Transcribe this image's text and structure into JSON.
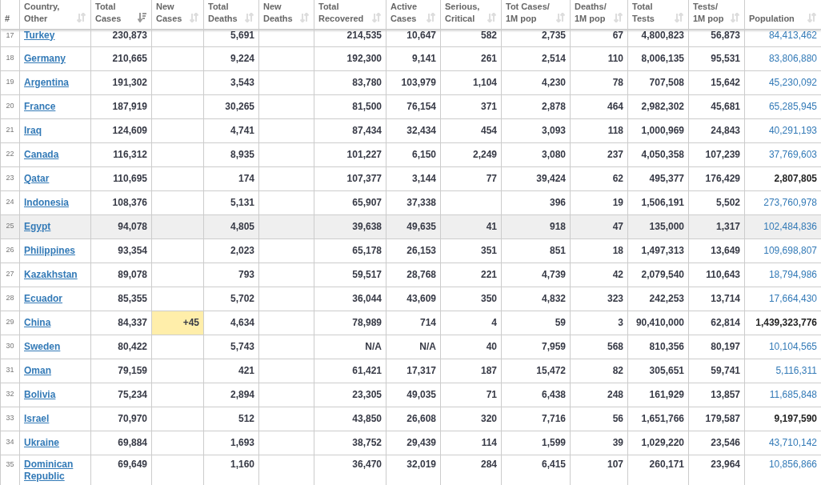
{
  "columns": [
    {
      "label": "#"
    },
    {
      "label": "Country,\nOther",
      "sorted": false
    },
    {
      "label": "Total\nCases",
      "sorted": true
    },
    {
      "label": "New\nCases",
      "sorted": false
    },
    {
      "label": "Total\nDeaths",
      "sorted": false
    },
    {
      "label": "New\nDeaths",
      "sorted": false
    },
    {
      "label": "Total\nRecovered",
      "sorted": false
    },
    {
      "label": "Active\nCases",
      "sorted": false
    },
    {
      "label": "Serious,\nCritical",
      "sorted": false
    },
    {
      "label": "Tot Cases/\n1M pop",
      "sorted": false
    },
    {
      "label": "Deaths/\n1M pop",
      "sorted": false
    },
    {
      "label": "Total\nTests",
      "sorted": false
    },
    {
      "label": "Tests/\n1M pop",
      "sorted": false
    },
    {
      "label": "Population",
      "sorted": false
    }
  ],
  "rows": [
    {
      "rank": "17",
      "country": "Turkey",
      "total_cases": "230,873",
      "total_deaths": "5,691",
      "total_recovered": "214,535",
      "active_cases": "10,647",
      "serious_critical": "582",
      "cases_per_1m": "2,735",
      "deaths_per_1m": "67",
      "total_tests": "4,800,823",
      "tests_per_1m": "56,873",
      "population": "84,413,462",
      "population_linked": true,
      "highlighted": false
    },
    {
      "rank": "18",
      "country": "Germany",
      "total_cases": "210,665",
      "total_deaths": "9,224",
      "total_recovered": "192,300",
      "active_cases": "9,141",
      "serious_critical": "261",
      "cases_per_1m": "2,514",
      "deaths_per_1m": "110",
      "total_tests": "8,006,135",
      "tests_per_1m": "95,531",
      "population": "83,806,880",
      "population_linked": true,
      "highlighted": false
    },
    {
      "rank": "19",
      "country": "Argentina",
      "total_cases": "191,302",
      "total_deaths": "3,543",
      "total_recovered": "83,780",
      "active_cases": "103,979",
      "serious_critical": "1,104",
      "cases_per_1m": "4,230",
      "deaths_per_1m": "78",
      "total_tests": "707,508",
      "tests_per_1m": "15,642",
      "population": "45,230,092",
      "population_linked": true,
      "highlighted": false
    },
    {
      "rank": "20",
      "country": "France",
      "total_cases": "187,919",
      "total_deaths": "30,265",
      "total_recovered": "81,500",
      "active_cases": "76,154",
      "serious_critical": "371",
      "cases_per_1m": "2,878",
      "deaths_per_1m": "464",
      "total_tests": "2,982,302",
      "tests_per_1m": "45,681",
      "population": "65,285,945",
      "population_linked": true,
      "highlighted": false
    },
    {
      "rank": "21",
      "country": "Iraq",
      "total_cases": "124,609",
      "total_deaths": "4,741",
      "total_recovered": "87,434",
      "active_cases": "32,434",
      "serious_critical": "454",
      "cases_per_1m": "3,093",
      "deaths_per_1m": "118",
      "total_tests": "1,000,969",
      "tests_per_1m": "24,843",
      "population": "40,291,193",
      "population_linked": true,
      "highlighted": false
    },
    {
      "rank": "22",
      "country": "Canada",
      "total_cases": "116,312",
      "total_deaths": "8,935",
      "total_recovered": "101,227",
      "active_cases": "6,150",
      "serious_critical": "2,249",
      "cases_per_1m": "3,080",
      "deaths_per_1m": "237",
      "total_tests": "4,050,358",
      "tests_per_1m": "107,239",
      "population": "37,769,603",
      "population_linked": true,
      "highlighted": false
    },
    {
      "rank": "23",
      "country": "Qatar",
      "total_cases": "110,695",
      "total_deaths": "174",
      "total_recovered": "107,377",
      "active_cases": "3,144",
      "serious_critical": "77",
      "cases_per_1m": "39,424",
      "deaths_per_1m": "62",
      "total_tests": "495,377",
      "tests_per_1m": "176,429",
      "population": "2,807,805",
      "population_linked": false,
      "highlighted": false
    },
    {
      "rank": "24",
      "country": "Indonesia",
      "total_cases": "108,376",
      "total_deaths": "5,131",
      "total_recovered": "65,907",
      "active_cases": "37,338",
      "cases_per_1m": "396",
      "deaths_per_1m": "19",
      "total_tests": "1,506,191",
      "tests_per_1m": "5,502",
      "population": "273,760,978",
      "population_linked": true,
      "highlighted": false
    },
    {
      "rank": "25",
      "country": "Egypt",
      "total_cases": "94,078",
      "total_deaths": "4,805",
      "total_recovered": "39,638",
      "active_cases": "49,635",
      "serious_critical": "41",
      "cases_per_1m": "918",
      "deaths_per_1m": "47",
      "total_tests": "135,000",
      "tests_per_1m": "1,317",
      "population": "102,484,836",
      "population_linked": true,
      "highlighted": true
    },
    {
      "rank": "26",
      "country": "Philippines",
      "total_cases": "93,354",
      "total_deaths": "2,023",
      "total_recovered": "65,178",
      "active_cases": "26,153",
      "serious_critical": "351",
      "cases_per_1m": "851",
      "deaths_per_1m": "18",
      "total_tests": "1,497,313",
      "tests_per_1m": "13,649",
      "population": "109,698,807",
      "population_linked": true,
      "highlighted": false
    },
    {
      "rank": "27",
      "country": "Kazakhstan",
      "total_cases": "89,078",
      "total_deaths": "793",
      "total_recovered": "59,517",
      "active_cases": "28,768",
      "serious_critical": "221",
      "cases_per_1m": "4,739",
      "deaths_per_1m": "42",
      "total_tests": "2,079,540",
      "tests_per_1m": "110,643",
      "population": "18,794,986",
      "population_linked": true,
      "highlighted": false
    },
    {
      "rank": "28",
      "country": "Ecuador",
      "total_cases": "85,355",
      "total_deaths": "5,702",
      "total_recovered": "36,044",
      "active_cases": "43,609",
      "serious_critical": "350",
      "cases_per_1m": "4,832",
      "deaths_per_1m": "323",
      "total_tests": "242,253",
      "tests_per_1m": "13,714",
      "population": "17,664,430",
      "population_linked": true,
      "highlighted": false
    },
    {
      "rank": "29",
      "country": "China",
      "total_cases": "84,337",
      "new_cases": "+45",
      "total_deaths": "4,634",
      "total_recovered": "78,989",
      "active_cases": "714",
      "serious_critical": "4",
      "cases_per_1m": "59",
      "deaths_per_1m": "3",
      "total_tests": "90,410,000",
      "tests_per_1m": "62,814",
      "population": "1,439,323,776",
      "population_linked": false,
      "highlighted": false
    },
    {
      "rank": "30",
      "country": "Sweden",
      "total_cases": "80,422",
      "total_deaths": "5,743",
      "total_recovered": "N/A",
      "active_cases": "N/A",
      "serious_critical": "40",
      "cases_per_1m": "7,959",
      "deaths_per_1m": "568",
      "total_tests": "810,356",
      "tests_per_1m": "80,197",
      "population": "10,104,565",
      "population_linked": true,
      "highlighted": false
    },
    {
      "rank": "31",
      "country": "Oman",
      "total_cases": "79,159",
      "total_deaths": "421",
      "total_recovered": "61,421",
      "active_cases": "17,317",
      "serious_critical": "187",
      "cases_per_1m": "15,472",
      "deaths_per_1m": "82",
      "total_tests": "305,651",
      "tests_per_1m": "59,741",
      "population": "5,116,311",
      "population_linked": true,
      "highlighted": false
    },
    {
      "rank": "32",
      "country": "Bolivia",
      "total_cases": "75,234",
      "total_deaths": "2,894",
      "total_recovered": "23,305",
      "active_cases": "49,035",
      "serious_critical": "71",
      "cases_per_1m": "6,438",
      "deaths_per_1m": "248",
      "total_tests": "161,929",
      "tests_per_1m": "13,857",
      "population": "11,685,848",
      "population_linked": true,
      "highlighted": false
    },
    {
      "rank": "33",
      "country": "Israel",
      "total_cases": "70,970",
      "total_deaths": "512",
      "total_recovered": "43,850",
      "active_cases": "26,608",
      "serious_critical": "320",
      "cases_per_1m": "7,716",
      "deaths_per_1m": "56",
      "total_tests": "1,651,766",
      "tests_per_1m": "179,587",
      "population": "9,197,590",
      "population_linked": false,
      "highlighted": false
    },
    {
      "rank": "34",
      "country": "Ukraine",
      "total_cases": "69,884",
      "total_deaths": "1,693",
      "total_recovered": "38,752",
      "active_cases": "29,439",
      "serious_critical": "114",
      "cases_per_1m": "1,599",
      "deaths_per_1m": "39",
      "total_tests": "1,029,220",
      "tests_per_1m": "23,546",
      "population": "43,710,142",
      "population_linked": true,
      "highlighted": false
    },
    {
      "rank": "35",
      "country": "Dominican Republic",
      "total_cases": "69,649",
      "total_deaths": "1,160",
      "total_recovered": "36,470",
      "active_cases": "32,019",
      "serious_critical": "284",
      "cases_per_1m": "6,415",
      "deaths_per_1m": "107",
      "total_tests": "260,171",
      "tests_per_1m": "23,964",
      "population": "10,856,866",
      "population_linked": true,
      "highlighted": false
    }
  ]
}
